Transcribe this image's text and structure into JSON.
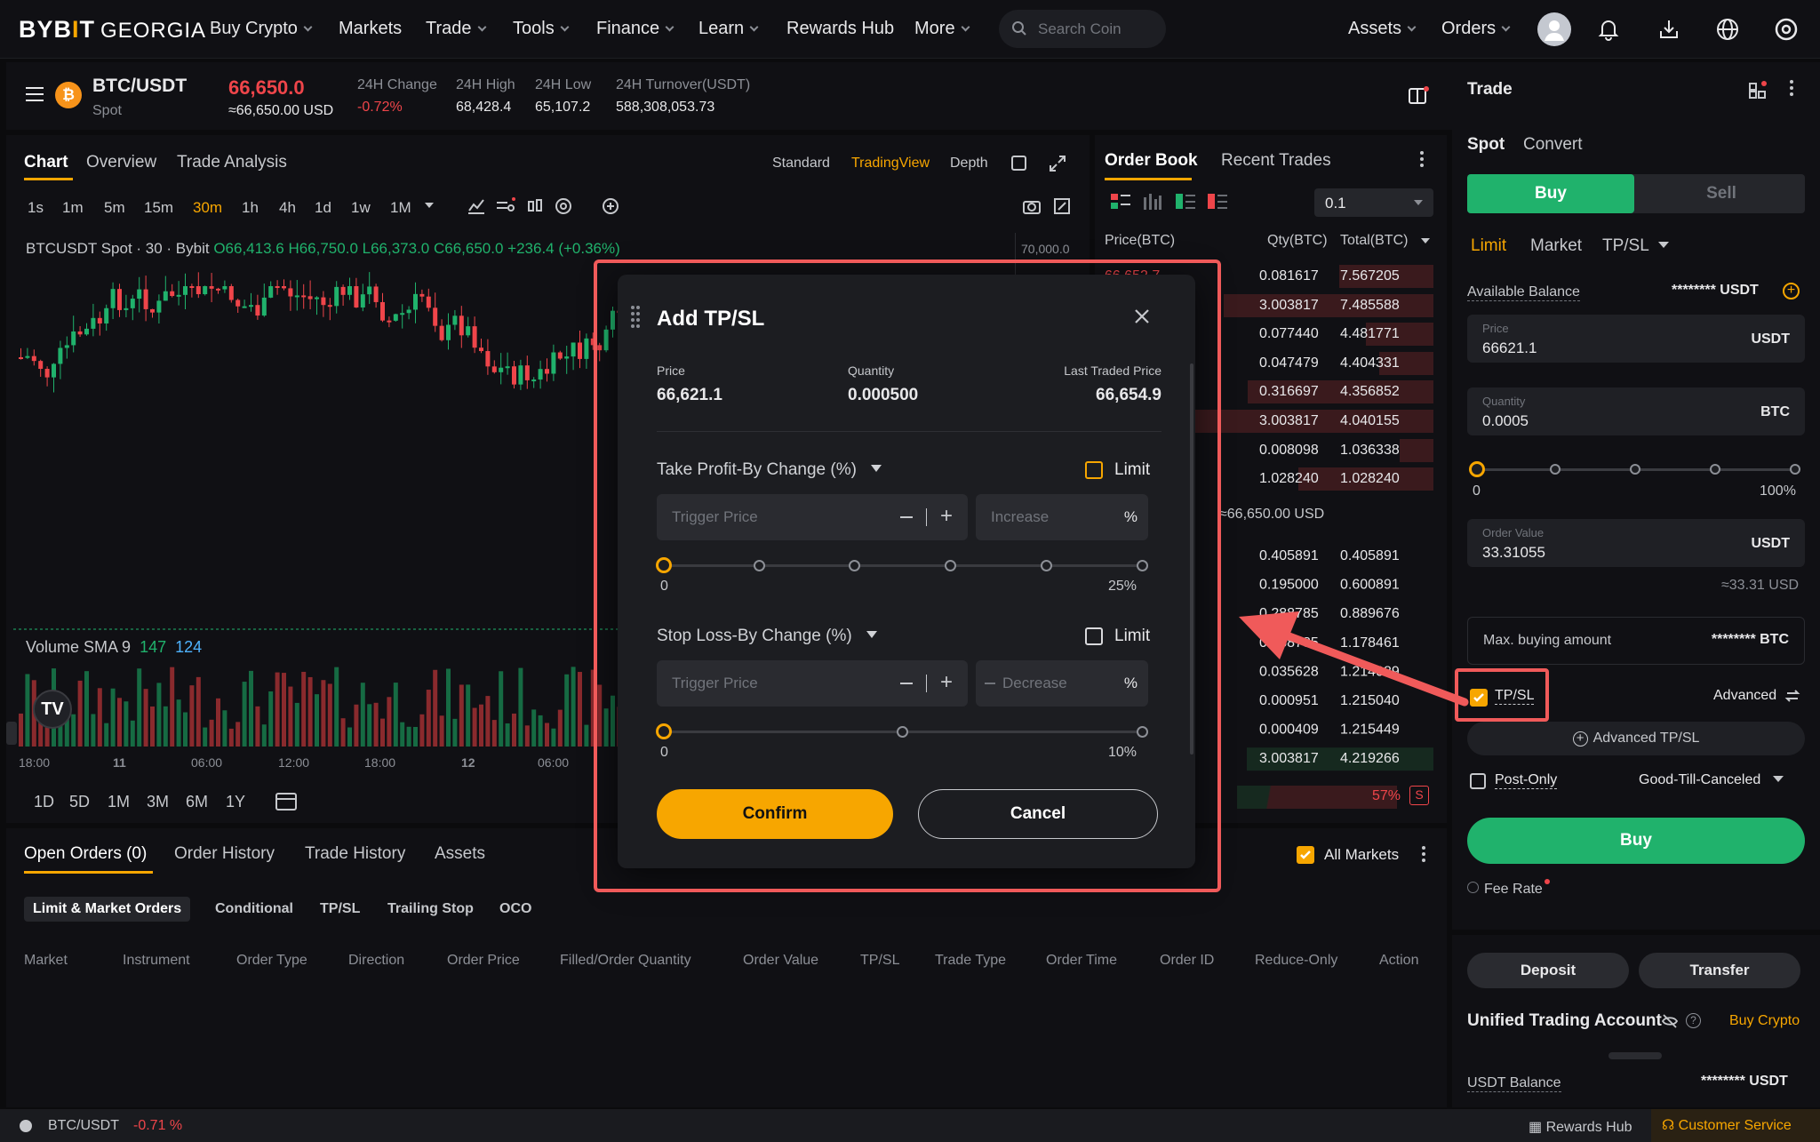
{
  "nav": {
    "logo_main": "BYB",
    "logo_tick": "I",
    "logo_end": "T",
    "logo_region": "GEORGIA",
    "items": [
      "Buy Crypto",
      "Markets",
      "Trade",
      "Tools",
      "Finance",
      "Learn",
      "Rewards Hub",
      "More"
    ],
    "search_placeholder": "Search Coin",
    "assets": "Assets",
    "orders": "Orders"
  },
  "ticker": {
    "pair": "BTC/USDT",
    "market": "Spot",
    "price": "66,650.0",
    "price_usd": "≈66,650.00 USD",
    "change_label": "24H Change",
    "change_value": "-0.72%",
    "high_label": "24H High",
    "high_value": "68,428.4",
    "low_label": "24H Low",
    "low_value": "65,107.2",
    "turnover_label": "24H Turnover(USDT)",
    "turnover_value": "588,308,053.73"
  },
  "chart_panel": {
    "tabs": [
      "Chart",
      "Overview",
      "Trade Analysis"
    ],
    "views": [
      "Standard",
      "TradingView",
      "Depth"
    ],
    "intervals": [
      "1s",
      "1m",
      "5m",
      "15m",
      "30m",
      "1h",
      "4h",
      "1d",
      "1w",
      "1M"
    ],
    "active_interval": "30m",
    "legend": "BTCUSDT Spot · 30 · Bybit",
    "ohlc": "O66,413.6 H66,750.0 L66,373.0 C66,650.0 +236.4 (+0.36%)",
    "price_scale_top": "70,000.0",
    "volume_label": "Volume SMA 9",
    "volume_v1": "147",
    "volume_v2": "124",
    "time_labels": [
      "18:00",
      "11",
      "06:00",
      "12:00",
      "18:00",
      "12",
      "06:00"
    ],
    "ranges": [
      "1D",
      "5D",
      "1M",
      "3M",
      "6M",
      "1Y"
    ]
  },
  "orderbook": {
    "tabs": [
      "Order Book",
      "Recent Trades"
    ],
    "precision": "0.1",
    "col_price": "Price(BTC)",
    "col_qty": "Qty(BTC)",
    "col_total": "Total(BTC)",
    "asks": [
      {
        "price": "66,652.7",
        "qty": "0.081617",
        "total": "7.567205"
      },
      {
        "price": "",
        "qty": "3.003817",
        "total": "7.485588"
      },
      {
        "price": "",
        "qty": "0.077440",
        "total": "4.481771"
      },
      {
        "price": "",
        "qty": "0.047479",
        "total": "4.404331"
      },
      {
        "price": "",
        "qty": "0.316697",
        "total": "4.356852"
      },
      {
        "price": "",
        "qty": "3.003817",
        "total": "4.040155"
      },
      {
        "price": "",
        "qty": "0.008098",
        "total": "1.036338"
      },
      {
        "price": "",
        "qty": "1.028240",
        "total": "1.028240"
      }
    ],
    "mid_usd": "≈66,650.00 USD",
    "bids": [
      {
        "qty": "0.405891",
        "total": "0.405891"
      },
      {
        "qty": "0.195000",
        "total": "0.600891"
      },
      {
        "qty": "0.288785",
        "total": "0.889676"
      },
      {
        "qty": "0.288785",
        "total": "1.178461"
      },
      {
        "qty": "0.035628",
        "total": "1.214089"
      },
      {
        "qty": "0.000951",
        "total": "1.215040"
      },
      {
        "qty": "0.000409",
        "total": "1.215449"
      },
      {
        "qty": "3.003817",
        "total": "4.219266"
      }
    ],
    "sell_ratio": "57%",
    "sell_badge": "S"
  },
  "bottom": {
    "tabs": [
      "Open Orders (0)",
      "Order History",
      "Trade History",
      "Assets"
    ],
    "all_markets": "All Markets",
    "subtabs": [
      "Limit & Market Orders",
      "Conditional",
      "TP/SL",
      "Trailing Stop",
      "OCO"
    ],
    "columns": [
      "Market",
      "Instrument",
      "Order Type",
      "Direction",
      "Order Price",
      "Filled/Order Quantity",
      "Order Value",
      "TP/SL",
      "Trade Type",
      "Order Time",
      "Order ID",
      "Reduce-Only",
      "Action"
    ]
  },
  "modal": {
    "title": "Add TP/SL",
    "price_label": "Price",
    "price_value": "66,621.1",
    "qty_label": "Quantity",
    "qty_value": "0.000500",
    "ltp_label": "Last Traded Price",
    "ltp_value": "66,654.9",
    "tp_label": "Take Profit-By Change (%)",
    "sl_label": "Stop Loss-By Change (%)",
    "limit_label": "Limit",
    "trigger_placeholder": "Trigger Price",
    "increase_placeholder": "Increase",
    "decrease_placeholder": "Decrease",
    "percent": "%",
    "tp_min": "0",
    "tp_max": "25%",
    "sl_min": "0",
    "sl_max": "10%",
    "confirm": "Confirm",
    "cancel": "Cancel"
  },
  "trade": {
    "title": "Trade",
    "tabs": [
      "Spot",
      "Convert"
    ],
    "buy": "Buy",
    "sell": "Sell",
    "order_types": [
      "Limit",
      "Market",
      "TP/SL"
    ],
    "available_label": "Available Balance",
    "available_value": "******** USDT",
    "price_label": "Price",
    "price_value": "66621.1",
    "price_unit": "USDT",
    "qty_label": "Quantity",
    "qty_value": "0.0005",
    "qty_unit": "BTC",
    "slider_min": "0",
    "slider_max": "100%",
    "value_label": "Order Value",
    "value_value": "33.31055",
    "value_unit": "USDT",
    "value_approx": "≈33.31 USD",
    "max_label": "Max. buying amount",
    "max_value": "******** BTC",
    "tpsl_label": "TP/SL",
    "advanced": "Advanced",
    "advanced_tpsl": "Advanced TP/SL",
    "post_only": "Post-Only",
    "tif": "Good-Till-Canceled",
    "buy_button": "Buy",
    "fee_rate": "Fee Rate",
    "deposit": "Deposit",
    "transfer": "Transfer",
    "uta_title": "Unified Trading Account",
    "buy_crypto": "Buy Crypto",
    "usdt_balance_label": "USDT Balance",
    "usdt_balance_value": "******** USDT"
  },
  "status": {
    "pair": "BTC/USDT",
    "change": "-0.71 %",
    "rewards": "Rewards Hub",
    "support": "Customer Service"
  },
  "colors": {
    "accent": "#f7a600",
    "up": "#20b26c",
    "down": "#ef454a",
    "highlight": "#f05a5a"
  }
}
